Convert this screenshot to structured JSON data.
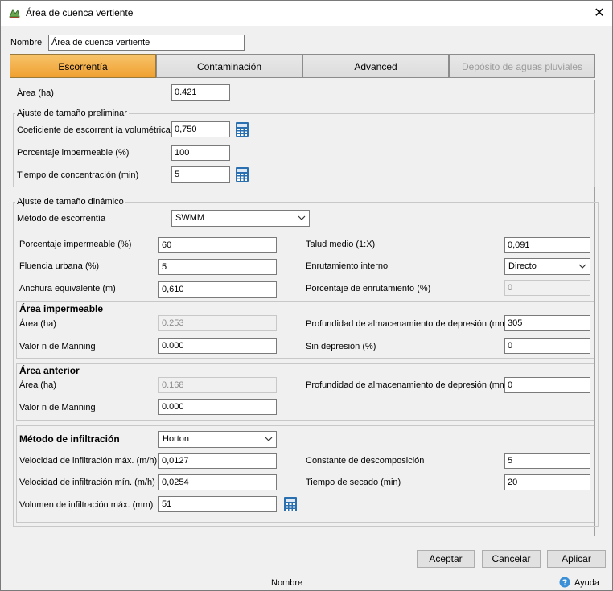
{
  "window": {
    "title": "Área de cuenca vertiente",
    "close_glyph": "✕"
  },
  "name_field": {
    "label": "Nombre",
    "value": "Área de cuenca vertiente"
  },
  "tabs": [
    {
      "label": "Escorrentía",
      "state": "active"
    },
    {
      "label": "Contaminación",
      "state": "normal"
    },
    {
      "label": "Advanced",
      "state": "normal"
    },
    {
      "label": "Depósito de aguas pluviales",
      "state": "disabled"
    }
  ],
  "area": {
    "label": "Área (ha)",
    "value": "0.421"
  },
  "preliminary": {
    "title": "Ajuste de tamaño preliminar",
    "runoff_coef": {
      "label": "Coeficiente de escorrent ía volumétrica",
      "value": "0,750"
    },
    "impervious_pct": {
      "label": "Porcentaje impermeable (%)",
      "value": "100"
    },
    "concentration_time": {
      "label": "Tiempo de concentración (min)",
      "value": "5"
    }
  },
  "dynamic": {
    "title": "Ajuste de tamaño dinámico",
    "runoff_method": {
      "label": "Método de escorrentía",
      "value": "SWMM"
    },
    "impervious_pct": {
      "label": "Porcentaje impermeable (%)",
      "value": "60"
    },
    "urban_flow": {
      "label": "Fluencia urbana (%)",
      "value": "5"
    },
    "equiv_width": {
      "label": "Anchura equivalente (m)",
      "value": "0,610"
    },
    "mean_slope": {
      "label": "Talud medio (1:X)",
      "value": "0,091"
    },
    "internal_routing": {
      "label": "Enrutamiento interno",
      "value": "Directo"
    },
    "routing_pct": {
      "label": "Porcentaje de enrutamiento (%)",
      "value": "0"
    }
  },
  "impervious_area": {
    "title": "Área impermeable",
    "area": {
      "label": "Área (ha)",
      "value": "0.253"
    },
    "manning": {
      "label": "Valor n de Manning",
      "value": "0.000"
    },
    "depression_depth": {
      "label": "Profundidad de almacenamiento de depresión (mm)",
      "value": "305"
    },
    "no_depression": {
      "label": "Sin depresión (%)",
      "value": "0"
    }
  },
  "pervious_area": {
    "title": "Área anterior",
    "area": {
      "label": "Área (ha)",
      "value": "0.168"
    },
    "manning": {
      "label": "Valor n de Manning",
      "value": "0.000"
    },
    "depression_depth": {
      "label": "Profundidad de almacenamiento de depresión (mm)",
      "value": "0"
    }
  },
  "infiltration": {
    "method": {
      "label": "Método de infiltración",
      "value": "Horton"
    },
    "max_rate": {
      "label": "Velocidad de infiltración máx. (m/h)",
      "value": "0,0127"
    },
    "min_rate": {
      "label": "Velocidad de infiltración mín. (m/h)",
      "value": "0,0254"
    },
    "max_volume": {
      "label": "Volumen de infiltración máx. (mm)",
      "value": "51"
    },
    "decay_constant": {
      "label": "Constante de descomposición",
      "value": "5"
    },
    "drying_time": {
      "label": "Tiempo de secado (min)",
      "value": "20"
    }
  },
  "buttons": {
    "accept": "Aceptar",
    "cancel": "Cancelar",
    "apply": "Aplicar"
  },
  "footer": {
    "status": "Nombre",
    "help": "Ayuda"
  },
  "colors": {
    "active_tab": "#f0a030",
    "calc_icon": "#2a6fb0"
  }
}
